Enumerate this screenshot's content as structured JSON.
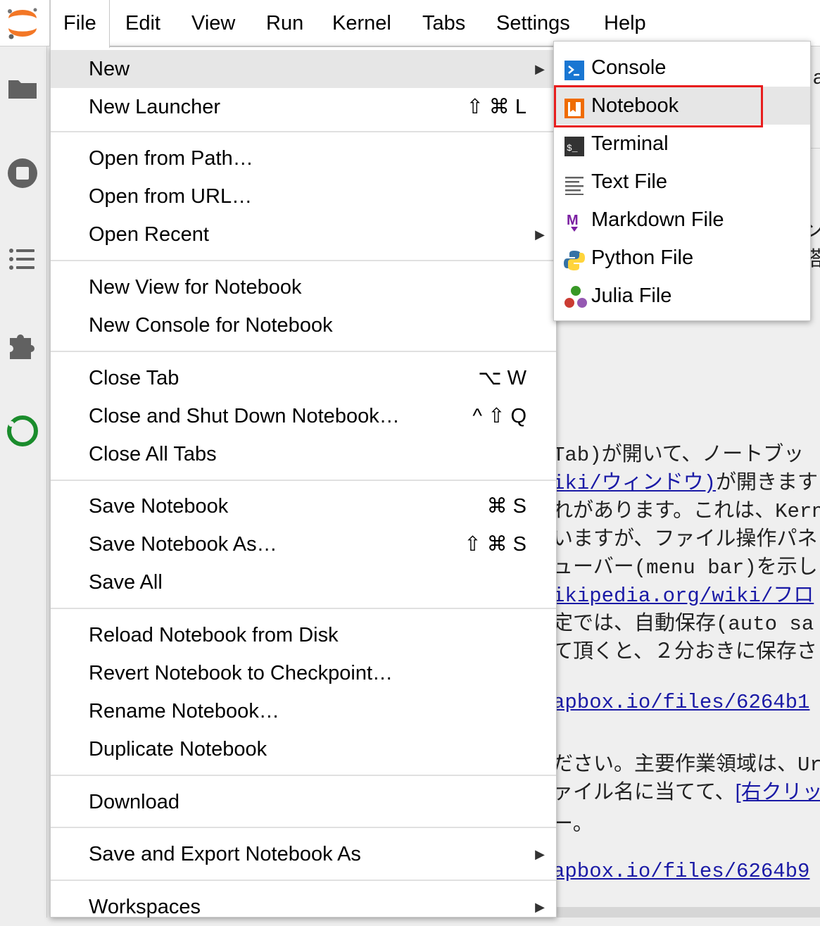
{
  "menubar": {
    "items": [
      "File",
      "Edit",
      "View",
      "Run",
      "Kernel",
      "Tabs",
      "Settings",
      "Help"
    ],
    "active": "File"
  },
  "colors": {
    "highlight_box": "#e81d1d",
    "jupyter_orange": "#f37726",
    "link": "#1a1aa6",
    "hover": "#e6e6e6"
  },
  "file_menu": {
    "new": "New",
    "new_launcher": "New Launcher",
    "new_launcher_shortcut": "⇧ ⌘ L",
    "open_from_path": "Open from Path…",
    "open_from_url": "Open from URL…",
    "open_recent": "Open Recent",
    "new_view": "New View for Notebook",
    "new_console": "New Console for Notebook",
    "close_tab": "Close Tab",
    "close_tab_shortcut": "⌥ W",
    "close_shutdown": "Close and Shut Down Notebook…",
    "close_shutdown_shortcut": "^ ⇧ Q",
    "close_all": "Close All Tabs",
    "save": "Save Notebook",
    "save_shortcut": "⌘ S",
    "save_as": "Save Notebook As…",
    "save_as_shortcut": "⇧ ⌘ S",
    "save_all": "Save All",
    "reload": "Reload Notebook from Disk",
    "revert": "Revert Notebook to Checkpoint…",
    "rename": "Rename Notebook…",
    "duplicate": "Duplicate Notebook",
    "download": "Download",
    "export": "Save and Export Notebook As",
    "workspaces": "Workspaces"
  },
  "new_submenu": {
    "console": "Console",
    "notebook": "Notebook",
    "terminal": "Terminal",
    "text_file": "Text File",
    "markdown_file": "Markdown File",
    "python_file": "Python File",
    "julia_file": "Julia File"
  },
  "background": {
    "partial_a": "a",
    "line1": "Tab)が開いて、ノートブッ",
    "line2_link": "iki/ウィンドウ)",
    "line2_text": "が開きます",
    "line3": "れがあります。これは、Kern",
    "line4": "いますが、ファイル操作パネ",
    "line5": "ューバー(menu bar)を示し",
    "line6_link": "ikipedia.org/wiki/フロ",
    "line7": "定では、自動保存(auto sa",
    "line8": "て頂くと、２分おきに保存さ",
    "line9_link": "apbox.io/files/6264b1",
    "line10": "ださい。主要作業領域は、Ur",
    "line11_text": "ァイル名に当てて、",
    "line11_link": "[右クリッ",
    "line12": "ー。",
    "line13_link": "apbox.io/files/6264b9"
  }
}
